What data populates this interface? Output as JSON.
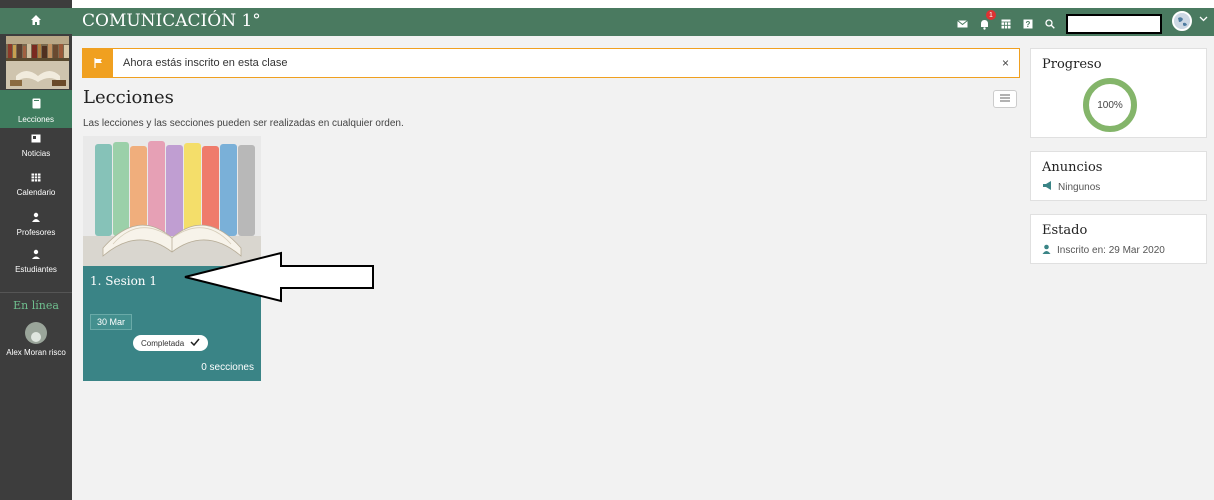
{
  "header": {
    "title": "COMUNICACIÓN 1°",
    "notification_count": "1"
  },
  "sidebar": {
    "items": [
      {
        "label": "Lecciones",
        "icon": "book-icon",
        "active": true
      },
      {
        "label": "Noticias",
        "icon": "news-icon",
        "active": false
      },
      {
        "label": "Calendario",
        "icon": "calendar-icon",
        "active": false
      },
      {
        "label": "Profesores",
        "icon": "teacher-icon",
        "active": false
      },
      {
        "label": "Estudiantes",
        "icon": "student-icon",
        "active": false
      }
    ],
    "online_label": "En línea",
    "online_user": "Alex Moran risco"
  },
  "notice": {
    "message": "Ahora estás inscrito en esta clase",
    "close": "×"
  },
  "main": {
    "heading": "Lecciones",
    "subtitle": "Las lecciones y las secciones pueden ser realizadas en cualquier orden."
  },
  "lesson_card": {
    "title": "1. Sesion 1",
    "date": "30 Mar",
    "status": "Completada",
    "sections": "0 secciones"
  },
  "panels": {
    "progress": {
      "title": "Progreso",
      "value": "100%",
      "fraction": 1.0
    },
    "announcements": {
      "title": "Anuncios",
      "value": "Ningunos"
    },
    "status": {
      "title": "Estado",
      "value": "Inscrito en: 29 Mar 2020"
    }
  },
  "colors": {
    "brand": "#4a7a60",
    "card": "#3a8486",
    "notice": "#f0a020",
    "progress_ring": "#84b56a"
  }
}
